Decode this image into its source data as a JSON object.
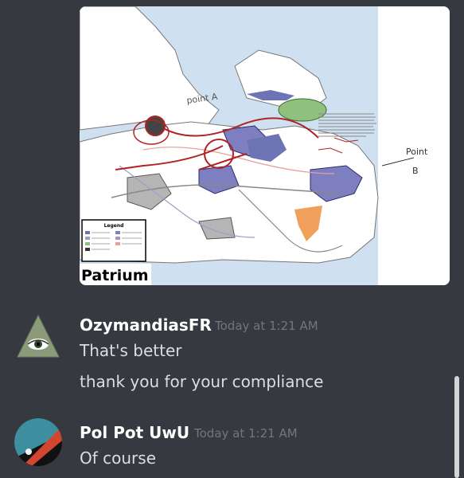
{
  "attachment": {
    "map_title": "Patrium",
    "legend_title": "Legend",
    "point_a_label": "point A",
    "point_b_label_1": "Point",
    "point_b_label_2": "B"
  },
  "messages": [
    {
      "author": "OzymandiasFR",
      "timestamp": "Today at 1:21 AM",
      "lines": [
        "That's better",
        "thank you for your compliance"
      ],
      "avatar_icon": "illuminati-eye-icon"
    },
    {
      "author": "Pol Pot UwU",
      "timestamp": "Today at 1:21 AM",
      "lines": [
        "Of course"
      ],
      "avatar_icon": "pol-pot-avatar-icon"
    }
  ],
  "colors": {
    "background": "#36393f",
    "author": "#ffffff",
    "text": "#dcddde",
    "timestamp": "#72767d"
  }
}
